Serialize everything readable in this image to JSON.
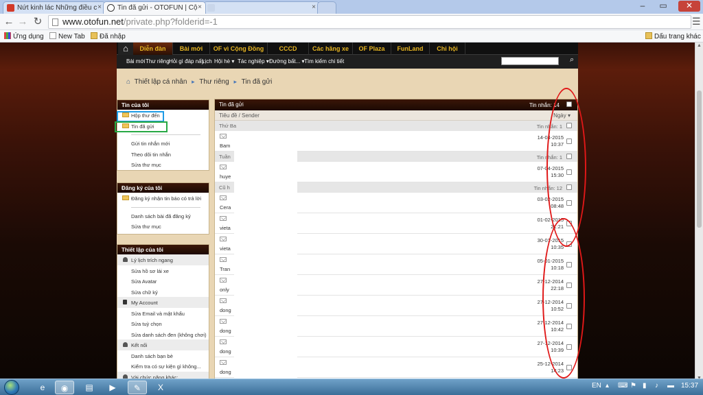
{
  "browser": {
    "tabs": [
      {
        "title": "Nứt kinh lác Những điều c",
        "active": false
      },
      {
        "title": "Tin đã gửi - OTOFUN | Cộ",
        "active": true
      },
      {
        "title": "",
        "active": false
      }
    ],
    "url": "www.otofun.net",
    "url_path": "/private.php?folderid=-1",
    "bookmarks": [
      "Ứng dụng",
      "New Tab",
      "Đã nhập"
    ],
    "bookmarks_right": "Dấu trang khác"
  },
  "site": {
    "nav_main": [
      "Diễn đàn",
      "Bài mới",
      "OF vì Cộng Đồng",
      "CCCD",
      "Các hãng xe",
      "OF Plaza",
      "FunLand",
      "Chi hội"
    ],
    "nav_sub": [
      "Bài mới",
      "Thư riêng",
      "Hỏi gì đáp nấy",
      "Lịch",
      "Hội hè ▾",
      "Tác nghiệp ▾",
      "Đường bất... ▾",
      "Tìm kiếm chi tiết"
    ],
    "breadcrumb": [
      "Thiết lập cá nhân",
      "Thư riêng",
      "Tin đã gửi"
    ]
  },
  "sidebar": {
    "messages": {
      "title": "Tin của tôi",
      "folders": [
        "Hộp thư đến",
        "Tin đã gửi"
      ],
      "links": [
        "Gửi tin nhắn mới",
        "Theo dõi tin nhắn",
        "Sửa thư mục"
      ]
    },
    "subs": {
      "title": "Đăng ký của tôi",
      "folders": [
        "Đăng ký nhận tin báo có trả lời"
      ],
      "links": [
        "Danh sách bài đã đăng ký",
        "Sửa thư mục"
      ]
    },
    "settings": {
      "title": "Thiết lập của tôi",
      "g1": "Lý lịch trích ngang",
      "g1_links": [
        "Sửa hồ sơ lái xe",
        "Sửa Avatar",
        "Sửa chữ ký"
      ],
      "g2": "My Account",
      "g2_links": [
        "Sửa Email và mật khẩu",
        "Sửa tuỳ chọn",
        "Sửa danh sách đen (không chơi)"
      ],
      "g3": "Kết nối",
      "g3_links": [
        "Danh sách bạn bè",
        "Kiểm tra có sự kiện gì không..."
      ],
      "g4": "Vài chức năng khác:"
    }
  },
  "list": {
    "title": "Tin đã gửi",
    "total_label": "Tin nhắn: 14",
    "col_subject": "Tiêu đề / Sender",
    "col_sort": "Ngày ▾",
    "groups": [
      {
        "label": "Thứ Ba",
        "count": "Tin nhắn: 1",
        "rows": [
          {
            "sender": "Bam",
            "date": "14-04-2015",
            "time": "10:37"
          }
        ]
      },
      {
        "label": "Tuần",
        "count": "Tin nhắn: 1",
        "rows": [
          {
            "sender": "huye",
            "date": "07-04-2015",
            "time": "15:30"
          }
        ]
      },
      {
        "label": "Cũ h",
        "count": "Tin nhắn: 12",
        "rows": [
          {
            "sender": "Cera",
            "date": "03-02-2015",
            "time": "08:48"
          },
          {
            "sender": "vieta",
            "date": "01-02-2015",
            "time": "21:21"
          },
          {
            "sender": "vieta",
            "date": "30-01-2015",
            "time": "10:35"
          },
          {
            "sender": "Tran",
            "date": "05-01-2015",
            "time": "10:18"
          },
          {
            "sender": "only",
            "date": "27-12-2014",
            "time": "22:18"
          },
          {
            "sender": "dong",
            "date": "27-12-2014",
            "time": "10:52"
          },
          {
            "sender": "dong",
            "date": "27-12-2014",
            "time": "10:42"
          },
          {
            "sender": "dong",
            "date": "27-12-2014",
            "time": "10:39"
          },
          {
            "sender": "dong",
            "date": "25-12-2014",
            "time": "14:23"
          }
        ]
      }
    ]
  },
  "taskbar": {
    "lang": "EN",
    "clock": "15:37"
  },
  "colors": {
    "highlight_blue": "#1d9be6",
    "highlight_green": "#27a844",
    "annotation_red": "#e01818",
    "nav_gold": "#e6b422"
  }
}
